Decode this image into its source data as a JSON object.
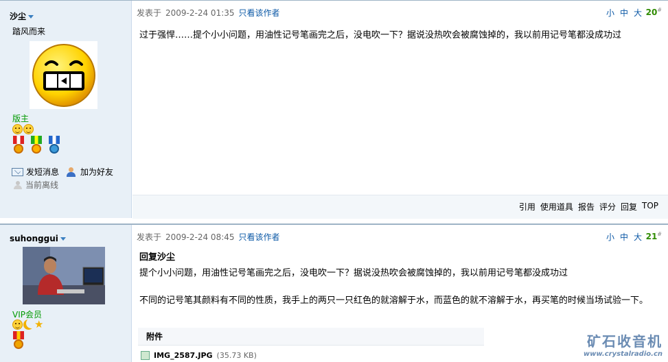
{
  "posts": [
    {
      "author": "沙尘",
      "custom_status": "踏风而来",
      "rank": "版主",
      "send_message": "发短消息",
      "add_friend": "加为好友",
      "online_status": "当前离线",
      "meta_prefix": "发表于",
      "date": "2009-2-24 01:35",
      "only_author": "只看该作者",
      "font_small": "小",
      "font_medium": "中",
      "font_large": "大",
      "floor": "20",
      "floor_mark": "#",
      "content": "过于强悍……提个小小问题，用油性记号笔画完之后，没电吹一下？据说没热吹会被腐蚀掉的，我以前用记号笔都没成功过",
      "actions": {
        "quote": "引用",
        "use_tool": "使用道具",
        "report": "报告",
        "rate": "评分",
        "reply": "回复",
        "top": "TOP"
      }
    },
    {
      "author": "suhonggui",
      "rank": "VIP会员",
      "meta_prefix": "发表于",
      "date": "2009-2-24 08:45",
      "only_author": "只看该作者",
      "font_small": "小",
      "font_medium": "中",
      "font_large": "大",
      "floor": "21",
      "floor_mark": "#",
      "reply_title": "回复沙尘",
      "quote": "提个小小问题，用油性记号笔画完之后，没电吹一下？据说没热吹会被腐蚀掉的，我以前用记号笔都没成功过",
      "content": "不同的记号笔其颜料有不同的性质，我手上的两只一只红色的就溶解于水，而蓝色的就不溶解于水，再买笔的时候当场试验一下。",
      "attachment_header": "附件",
      "attachment_name": "IMG_2587.JPG",
      "attachment_size": "(35.73 KB)"
    }
  ],
  "watermark": {
    "title": "矿石收音机",
    "url": "www.crystalradio.cn"
  }
}
